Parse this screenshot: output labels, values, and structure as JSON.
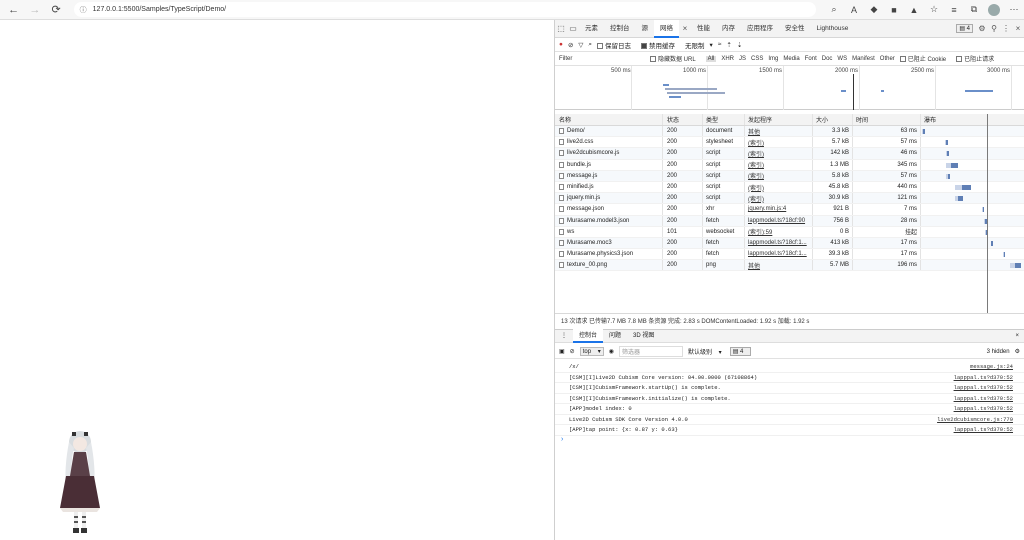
{
  "browser": {
    "url": "127.0.0.1:5500/Samples/TypeScript/Demo/"
  },
  "devtools": {
    "tabs": [
      "元素",
      "控制台",
      "源",
      "网络",
      "性能",
      "内存",
      "应用程序",
      "安全性",
      "Lighthouse"
    ],
    "active_tab": "网络",
    "issue_count": "4",
    "network_toolbar": {
      "preserve_log": "保留日志",
      "disable_cache": "禁用缓存",
      "throttle": "无限制"
    },
    "filter": {
      "placeholder": "Filter",
      "hide_data_urls": "隐藏数据 URL",
      "types": [
        "All",
        "XHR",
        "JS",
        "CSS",
        "Img",
        "Media",
        "Font",
        "Doc",
        "WS",
        "Manifest",
        "Other"
      ],
      "blocked_cookies": "已阻止 Cookie",
      "blocked_requests": "已阻止请求"
    },
    "overview_ticks": [
      "500 ms",
      "1000 ms",
      "1500 ms",
      "2000 ms",
      "2500 ms",
      "3000 ms"
    ],
    "columns": {
      "name": "名称",
      "status": "状态",
      "type": "类型",
      "initiator": "发起程序",
      "size": "大小",
      "time": "时间",
      "waterfall": "瀑布"
    },
    "requests": [
      {
        "name": "Demo/",
        "status": "200",
        "type": "document",
        "initiator": "其他",
        "size": "3.3 kB",
        "time": "63 ms",
        "wf_start": 0.01,
        "wf_len": 0.03
      },
      {
        "name": "live2d.css",
        "status": "200",
        "type": "stylesheet",
        "initiator": "(索引)",
        "size": "5.7 kB",
        "time": "57 ms",
        "wf_start": 0.23,
        "wf_len": 0.03
      },
      {
        "name": "live2dcubismcore.js",
        "status": "200",
        "type": "script",
        "initiator": "(索引)",
        "size": "142 kB",
        "time": "46 ms",
        "wf_start": 0.24,
        "wf_len": 0.03
      },
      {
        "name": "bundle.js",
        "status": "200",
        "type": "script",
        "initiator": "(索引)",
        "size": "1.3 MB",
        "time": "345 ms",
        "wf_start": 0.24,
        "wf_len": 0.12
      },
      {
        "name": "message.js",
        "status": "200",
        "type": "script",
        "initiator": "(索引)",
        "size": "5.8 kB",
        "time": "57 ms",
        "wf_start": 0.24,
        "wf_len": 0.04
      },
      {
        "name": "minified.js",
        "status": "200",
        "type": "script",
        "initiator": "(索引)",
        "size": "45.8 kB",
        "time": "440 ms",
        "wf_start": 0.33,
        "wf_len": 0.15
      },
      {
        "name": "jquery.min.js",
        "status": "200",
        "type": "script",
        "initiator": "(索引)",
        "size": "30.9 kB",
        "time": "121 ms",
        "wf_start": 0.33,
        "wf_len": 0.07
      },
      {
        "name": "message.json",
        "status": "200",
        "type": "xhr",
        "initiator": "jquery.min.js:4",
        "size": "921 B",
        "time": "7 ms",
        "wf_start": 0.59,
        "wf_len": 0.015
      },
      {
        "name": "Murasame.model3.json",
        "status": "200",
        "type": "fetch",
        "initiator": "lappmodel.ts?18cf:90",
        "size": "756 B",
        "time": "28 ms",
        "wf_start": 0.61,
        "wf_len": 0.015
      },
      {
        "name": "ws",
        "status": "101",
        "type": "websocket",
        "initiator": "(索引):59",
        "size": "0 B",
        "time": "挂起",
        "wf_start": 0.62,
        "wf_len": 0.01
      },
      {
        "name": "Murasame.moc3",
        "status": "200",
        "type": "fetch",
        "initiator": "lappmodel.ts?18cf:1...",
        "size": "413 kB",
        "time": "17 ms",
        "wf_start": 0.67,
        "wf_len": 0.015
      },
      {
        "name": "Murasame.physics3.json",
        "status": "200",
        "type": "fetch",
        "initiator": "lappmodel.ts?18cf:1...",
        "size": "39.3 kB",
        "time": "17 ms",
        "wf_start": 0.79,
        "wf_len": 0.015
      },
      {
        "name": "texture_00.png",
        "status": "200",
        "type": "png",
        "initiator": "其他",
        "size": "5.7 MB",
        "time": "196 ms",
        "wf_start": 0.86,
        "wf_len": 0.1
      }
    ],
    "summary": "13 次请求  已传输7.7 MB  7.8 MB 条资源  完成: 2.83 s  DOMContentLoaded: 1.92 s  加载: 1.92 s",
    "drawer_tabs": [
      "控制台",
      "问题",
      "3D 视图"
    ],
    "console_toolbar": {
      "context": "top",
      "filter_placeholder": "筛选器",
      "levels": "默认级别",
      "issues": "4",
      "hidden": "3 hidden"
    },
    "console_lines": [
      {
        "text": "/x/",
        "source": "message.js:24"
      },
      {
        "text": "[CSM][I]Live2D Cubism Core version: 04.00.0000 (67108864)",
        "source": "lapppal.ts?d370:52"
      },
      {
        "text": "[CSM][I]CubismFramework.startUp() is complete.",
        "source": "lapppal.ts?d370:52"
      },
      {
        "text": "[CSM][I]CubismFramework.initialize() is complete.",
        "source": "lapppal.ts?d370:52"
      },
      {
        "text": "[APP]model index: 0",
        "source": "lapppal.ts?d370:52"
      },
      {
        "text": "Live2D Cubism SDK Core Version 4.0.0",
        "source": "live2dcubismcore.js:779"
      },
      {
        "text": "[APP]tap point: {x: 0.87 y: 0.63}",
        "source": "lapppal.ts?d370:52"
      }
    ],
    "prompt": "›"
  }
}
